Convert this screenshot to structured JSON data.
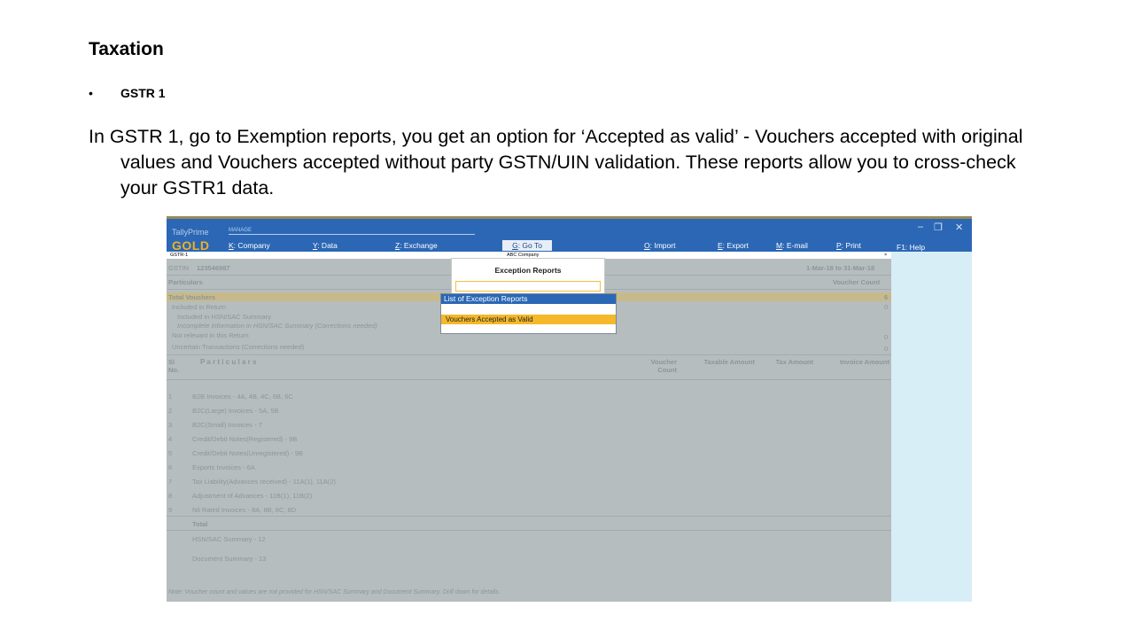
{
  "slide": {
    "title": "Taxation",
    "bullet_glyph": "•",
    "bullet": "GSTR 1",
    "paragraph": "In GSTR 1, go to Exemption reports, you get an option for ‘Accepted as valid’ - Vouchers accepted with original values and Vouchers accepted without party GSTN/UIN validation. These reports allow you to cross-check your GSTR1 data."
  },
  "app": {
    "brand_small": "TallyPrime",
    "brand_large": "GOLD",
    "manage_label": "MANAGE",
    "menu": [
      {
        "key": "K",
        "label": ": Company"
      },
      {
        "key": "Y",
        "label": ": Data"
      },
      {
        "key": "Z",
        "label": ": Exchange"
      },
      {
        "key": "O",
        "label": ": Import"
      },
      {
        "key": "E",
        "label": ": Export"
      },
      {
        "key": "M",
        "label": ": E-mail"
      },
      {
        "key": "P",
        "label": ": Print"
      }
    ],
    "goto": {
      "key": "G",
      "label": ": Go To"
    },
    "help": "F1: Help",
    "window_controls": [
      "–",
      "❐",
      "✕"
    ],
    "report_name": "GSTR-1",
    "company": "ABC Company",
    "close_glyph": "×"
  },
  "report": {
    "gstin_label": "GSTIN",
    "gstin_value": "123546987",
    "period": "1-Mar-18 to 31-Mar-18",
    "particulars_label": "Particulars",
    "voucher_count_label": "Voucher Count",
    "total_vouchers": "Total Vouchers",
    "total_vouchers_value": "6",
    "included_in_return": "Included in Return",
    "included_value": "0",
    "included_hsn": "Included in HSN/SAC Summary",
    "incomplete_hsn": "Incomplete information in HSN/SAC Summary (Corrections needed)",
    "not_relevant": "Not relevant in this Return",
    "not_relevant_value": "0",
    "uncertain": "Uncertain Transactions (Corrections needed)",
    "uncertain_value": "0",
    "table_headers": {
      "sl_no": "Sl No.",
      "particulars": "P a r t i c u l a r s",
      "voucher_count": "Voucher Count",
      "taxable_amount": "Taxable Amount",
      "tax_amount": "Tax Amount",
      "invoice_amount": "Invoice Amount"
    },
    "rows": [
      {
        "no": "1",
        "label": "B2B Invoices - 4A, 4B, 4C, 6B, 6C"
      },
      {
        "no": "2",
        "label": "B2C(Large) Invoices - 5A, 5B"
      },
      {
        "no": "3",
        "label": "B2C(Small) Invoices - 7"
      },
      {
        "no": "4",
        "label": "Credit/Debit Notes(Registered) - 9B"
      },
      {
        "no": "5",
        "label": "Credit/Debit Notes(Unregistered) - 9B"
      },
      {
        "no": "6",
        "label": "Exports Invoices - 6A"
      },
      {
        "no": "7",
        "label": "Tax Liability(Advances received) - 11A(1), 11A(2)"
      },
      {
        "no": "8",
        "label": "Adjustment of Advances - 11B(1), 11B(2)"
      },
      {
        "no": "9",
        "label": "Nil Rated Invoices - 8A, 8B, 8C, 8D"
      }
    ],
    "total": "Total",
    "hsn_summary": "HSN/SAC Summary - 12",
    "document_summary": "Document Summary - 13",
    "note": "Note: Voucher count and values are not provided for HSN/SAC Summary and Document Summary. Drill down for details."
  },
  "dialog": {
    "title": "Exception Reports",
    "input_value": "",
    "list_title": "List of Exception Reports",
    "options": [
      "Vouchers Accepted as Valid"
    ]
  }
}
